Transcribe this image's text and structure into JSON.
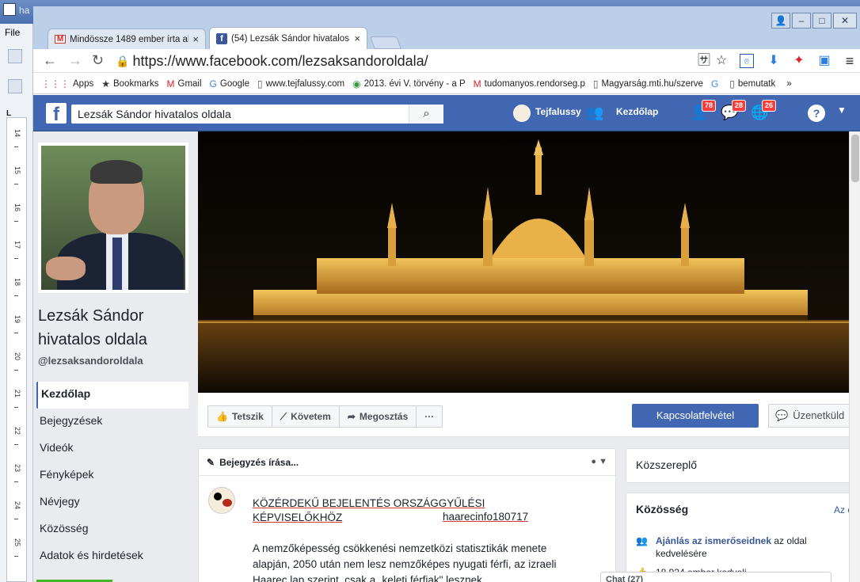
{
  "word": {
    "title": "ha",
    "file_menu": "File",
    "ruler_corner": "L",
    "ruler_ticks": [
      "14",
      "15",
      "16",
      "17",
      "18",
      "19",
      "20",
      "21",
      "22",
      "23",
      "24",
      "25"
    ]
  },
  "browser": {
    "tabs": [
      {
        "label": "Mindössze 1489 ember írta al",
        "icon": "gmail-icon",
        "close": "×"
      },
      {
        "label": "(54) Lezsák Sándor hivatalos",
        "icon": "facebook-icon",
        "close": "×"
      }
    ],
    "url": "https://www.facebook.com/lezsaksandoroldala/",
    "bookmarks": [
      {
        "label": "Apps",
        "icon": "apps-icon"
      },
      {
        "label": "Bookmarks",
        "icon": "star-icon"
      },
      {
        "label": "Gmail",
        "icon": "gmail-icon"
      },
      {
        "label": "Google",
        "icon": "google-icon"
      },
      {
        "label": "www.tejfalussy.com",
        "icon": "page-icon"
      },
      {
        "label": "2013. évi V. törvény - a P",
        "icon": "globe-icon"
      },
      {
        "label": "tudomanyos.rendorseg.p",
        "icon": "gmail-icon"
      },
      {
        "label": "Magyarság.mti.hu/szerve",
        "icon": "page-icon"
      },
      {
        "label": "",
        "icon": "google-icon"
      },
      {
        "label": "bemutatk",
        "icon": "page-icon"
      }
    ],
    "bookmarks_more": "»"
  },
  "facebook": {
    "search_value": "Lezsák Sándor hivatalos oldala",
    "user_name": "Tejfalussy",
    "home_label": "Kezdőlap",
    "badges": {
      "friends": "78",
      "messages": "28",
      "notifications": "26"
    },
    "help": "?",
    "page": {
      "name": "Lezsák Sándor hivatalos oldala",
      "handle": "@lezsaksandoroldala",
      "nav": [
        "Kezdőlap",
        "Bejegyzések",
        "Videók",
        "Fényképek",
        "Névjegy",
        "Közösség",
        "Adatok és hirdetések"
      ]
    },
    "actions": {
      "like": "Tetszik",
      "follow": "Követem",
      "share": "Megosztás",
      "more": "···",
      "contact": "Kapcsolatfelvétel",
      "message": "Üzenetküld"
    },
    "composer": {
      "label": "Bejegyzés írása..."
    },
    "post": {
      "title": "KÖZÉRDEKŰ BEJELENTÉS ORSZÁGGYŰLÉSI KÉPVISELŐKHÖZ",
      "tag": "haarecinfo180717",
      "body": "A nemzőképesség csökkenési nemzetközi statisztikák menete alapján, 2050 után nem lesz nemzőképes nyugati férfi, az izraeli Haarec lap szerint, csak a „keleti férfiak\" lesznek"
    },
    "right": {
      "category": "Közszereplő",
      "community_title": "Közösség",
      "community_link": "Az öss",
      "invite_bold": "Ajánlás az ismerőseidnek",
      "invite_rest": " az oldal kedvelésére",
      "likes_partial": "18 924 ember kedveli",
      "chat_label": "Chat (27)"
    }
  },
  "colors": {
    "fb_blue": "#4267b2",
    "badge_red": "#fa3e3e",
    "tab_bg": "#bccfe8"
  }
}
